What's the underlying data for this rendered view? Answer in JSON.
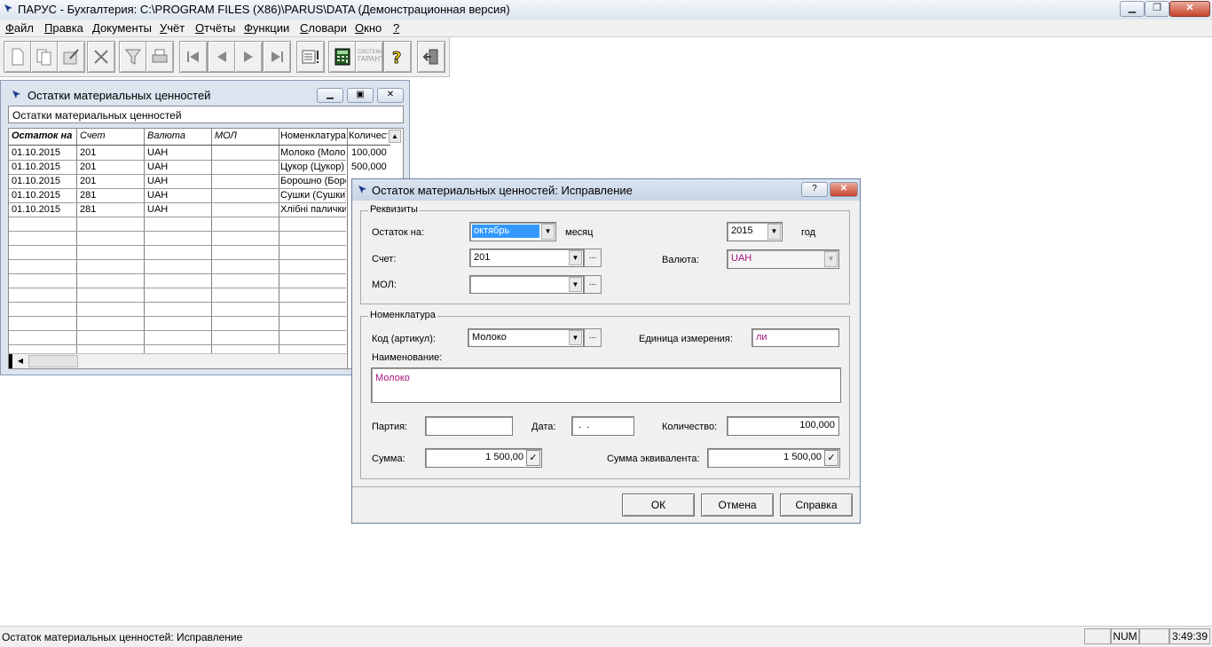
{
  "app": {
    "title": "ПАРУС - Бухгалтерия: C:\\PROGRAM FILES (X86)\\PARUS\\DATA (Демонстрационная версия)"
  },
  "menu": {
    "items": [
      {
        "u": "Ф",
        "rest": "айл"
      },
      {
        "u": "П",
        "rest": "равка"
      },
      {
        "u": "Д",
        "rest": "окументы"
      },
      {
        "u": "У",
        "rest": "чёт"
      },
      {
        "u": "О",
        "rest": "тчёты"
      },
      {
        "u": "Ф",
        "rest": "ункции"
      },
      {
        "u": "С",
        "rest": "ловари"
      },
      {
        "u": "О",
        "rest": "кно"
      },
      {
        "u": "?",
        "rest": ""
      }
    ]
  },
  "toolbar": {
    "icons": [
      "new-document-icon",
      "copy-document-icon",
      "edit-document-icon",
      "delete-icon",
      "filter-icon",
      "print-icon",
      "first-record-icon",
      "previous-record-icon",
      "next-record-icon",
      "last-record-icon",
      "list-window-icon",
      "calculator-icon",
      "sistema-garant-icon",
      "help-icon",
      "exit-icon"
    ],
    "garant_text_top": "СИСТЕМА",
    "garant_text_bottom": "ГАРАНТ"
  },
  "list_window": {
    "title": "Остатки материальных ценностей",
    "header_label": "Остатки материальных ценностей",
    "columns": [
      "Остаток на",
      "Счет",
      "Валюта",
      "МОЛ",
      "Номенклатура",
      "Количество"
    ],
    "rows": [
      {
        "date": "01.10.2015",
        "account": "201",
        "currency": "UAH",
        "mol": "",
        "nomenclature": "Молоко (Молоко)",
        "quantity": "100,000"
      },
      {
        "date": "01.10.2015",
        "account": "201",
        "currency": "UAH",
        "mol": "",
        "nomenclature": "Цукор (Цукор)",
        "quantity": "500,000"
      },
      {
        "date": "01.10.2015",
        "account": "201",
        "currency": "UAH",
        "mol": "",
        "nomenclature": "Борошно (Борошно)",
        "quantity": ""
      },
      {
        "date": "01.10.2015",
        "account": "281",
        "currency": "UAH",
        "mol": "",
        "nomenclature": "Сушки (Сушки)",
        "quantity": ""
      },
      {
        "date": "01.10.2015",
        "account": "281",
        "currency": "UAH",
        "mol": "",
        "nomenclature": "Хлібні палички",
        "quantity": ""
      }
    ]
  },
  "dialog": {
    "title": "Остаток материальных ценностей: Исправление",
    "help_button": "?",
    "requisites": {
      "group_title": "Реквизиты",
      "balance_label": "Остаток на:",
      "month_value": "октябрь",
      "month_label": "месяц",
      "year_value": "2015",
      "year_label": "год",
      "account_label": "Счет:",
      "account_value": "201",
      "currency_label": "Валюта:",
      "currency_value": "UAH",
      "mol_label": "МОЛ:",
      "mol_value": ""
    },
    "nomenclature": {
      "group_title": "Номенклатура",
      "code_label": "Код (артикул):",
      "code_value": "Молоко",
      "unit_label": "Единица измерения:",
      "unit_value": "ли",
      "name_label": "Наименование:",
      "name_value": "Молоко",
      "batch_label": "Партия:",
      "batch_value": "",
      "date_label": "Дата:",
      "date_value": " .  .",
      "quantity_label": "Количество:",
      "quantity_value": "100,000",
      "sum_label": "Сумма:",
      "sum_value": "1 500,00",
      "equiv_label": "Сумма эквивалента:",
      "equiv_value": "1 500,00"
    },
    "buttons": {
      "ok": "ОК",
      "cancel": "Отмена",
      "help": "Справка"
    }
  },
  "statusbar": {
    "text": "Остаток материальных ценностей: Исправление",
    "num": "NUM",
    "time": "3:49:39"
  }
}
